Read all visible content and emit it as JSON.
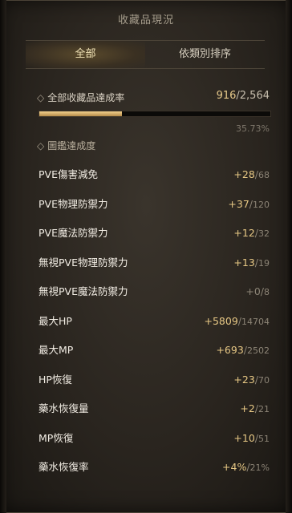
{
  "window": {
    "title": "收藏品現況"
  },
  "tabs": [
    {
      "label": "全部",
      "active": true
    },
    {
      "label": "依類別排序",
      "active": false
    }
  ],
  "summary": {
    "label": "全部收藏品達成率",
    "current": "916",
    "total": "2,564",
    "percent_text": "35.73%",
    "progress": 0.3573
  },
  "section": {
    "label": "圖鑑達成度"
  },
  "stats": [
    {
      "label": "PVE傷害減免",
      "current": "+28",
      "max": "68"
    },
    {
      "label": "PVE物理防禦力",
      "current": "+37",
      "max": "120"
    },
    {
      "label": "PVE魔法防禦力",
      "current": "+12",
      "max": "32"
    },
    {
      "label": "無視PVE物理防禦力",
      "current": "+13",
      "max": "19"
    },
    {
      "label": "無視PVE魔法防禦力",
      "current": "+0",
      "max": "8"
    },
    {
      "label": "最大HP",
      "current": "+5809",
      "max": "14704"
    },
    {
      "label": "最大MP",
      "current": "+693",
      "max": "2502"
    },
    {
      "label": "HP恢復",
      "current": "+23",
      "max": "70"
    },
    {
      "label": "藥水恢復量",
      "current": "+2",
      "max": "21"
    },
    {
      "label": "MP恢復",
      "current": "+10",
      "max": "51"
    },
    {
      "label": "藥水恢復率",
      "current": "+4%",
      "max": "21%"
    }
  ],
  "colors": {
    "accent": "#e7c885",
    "text": "#f2ede4",
    "muted": "#8c8476"
  }
}
